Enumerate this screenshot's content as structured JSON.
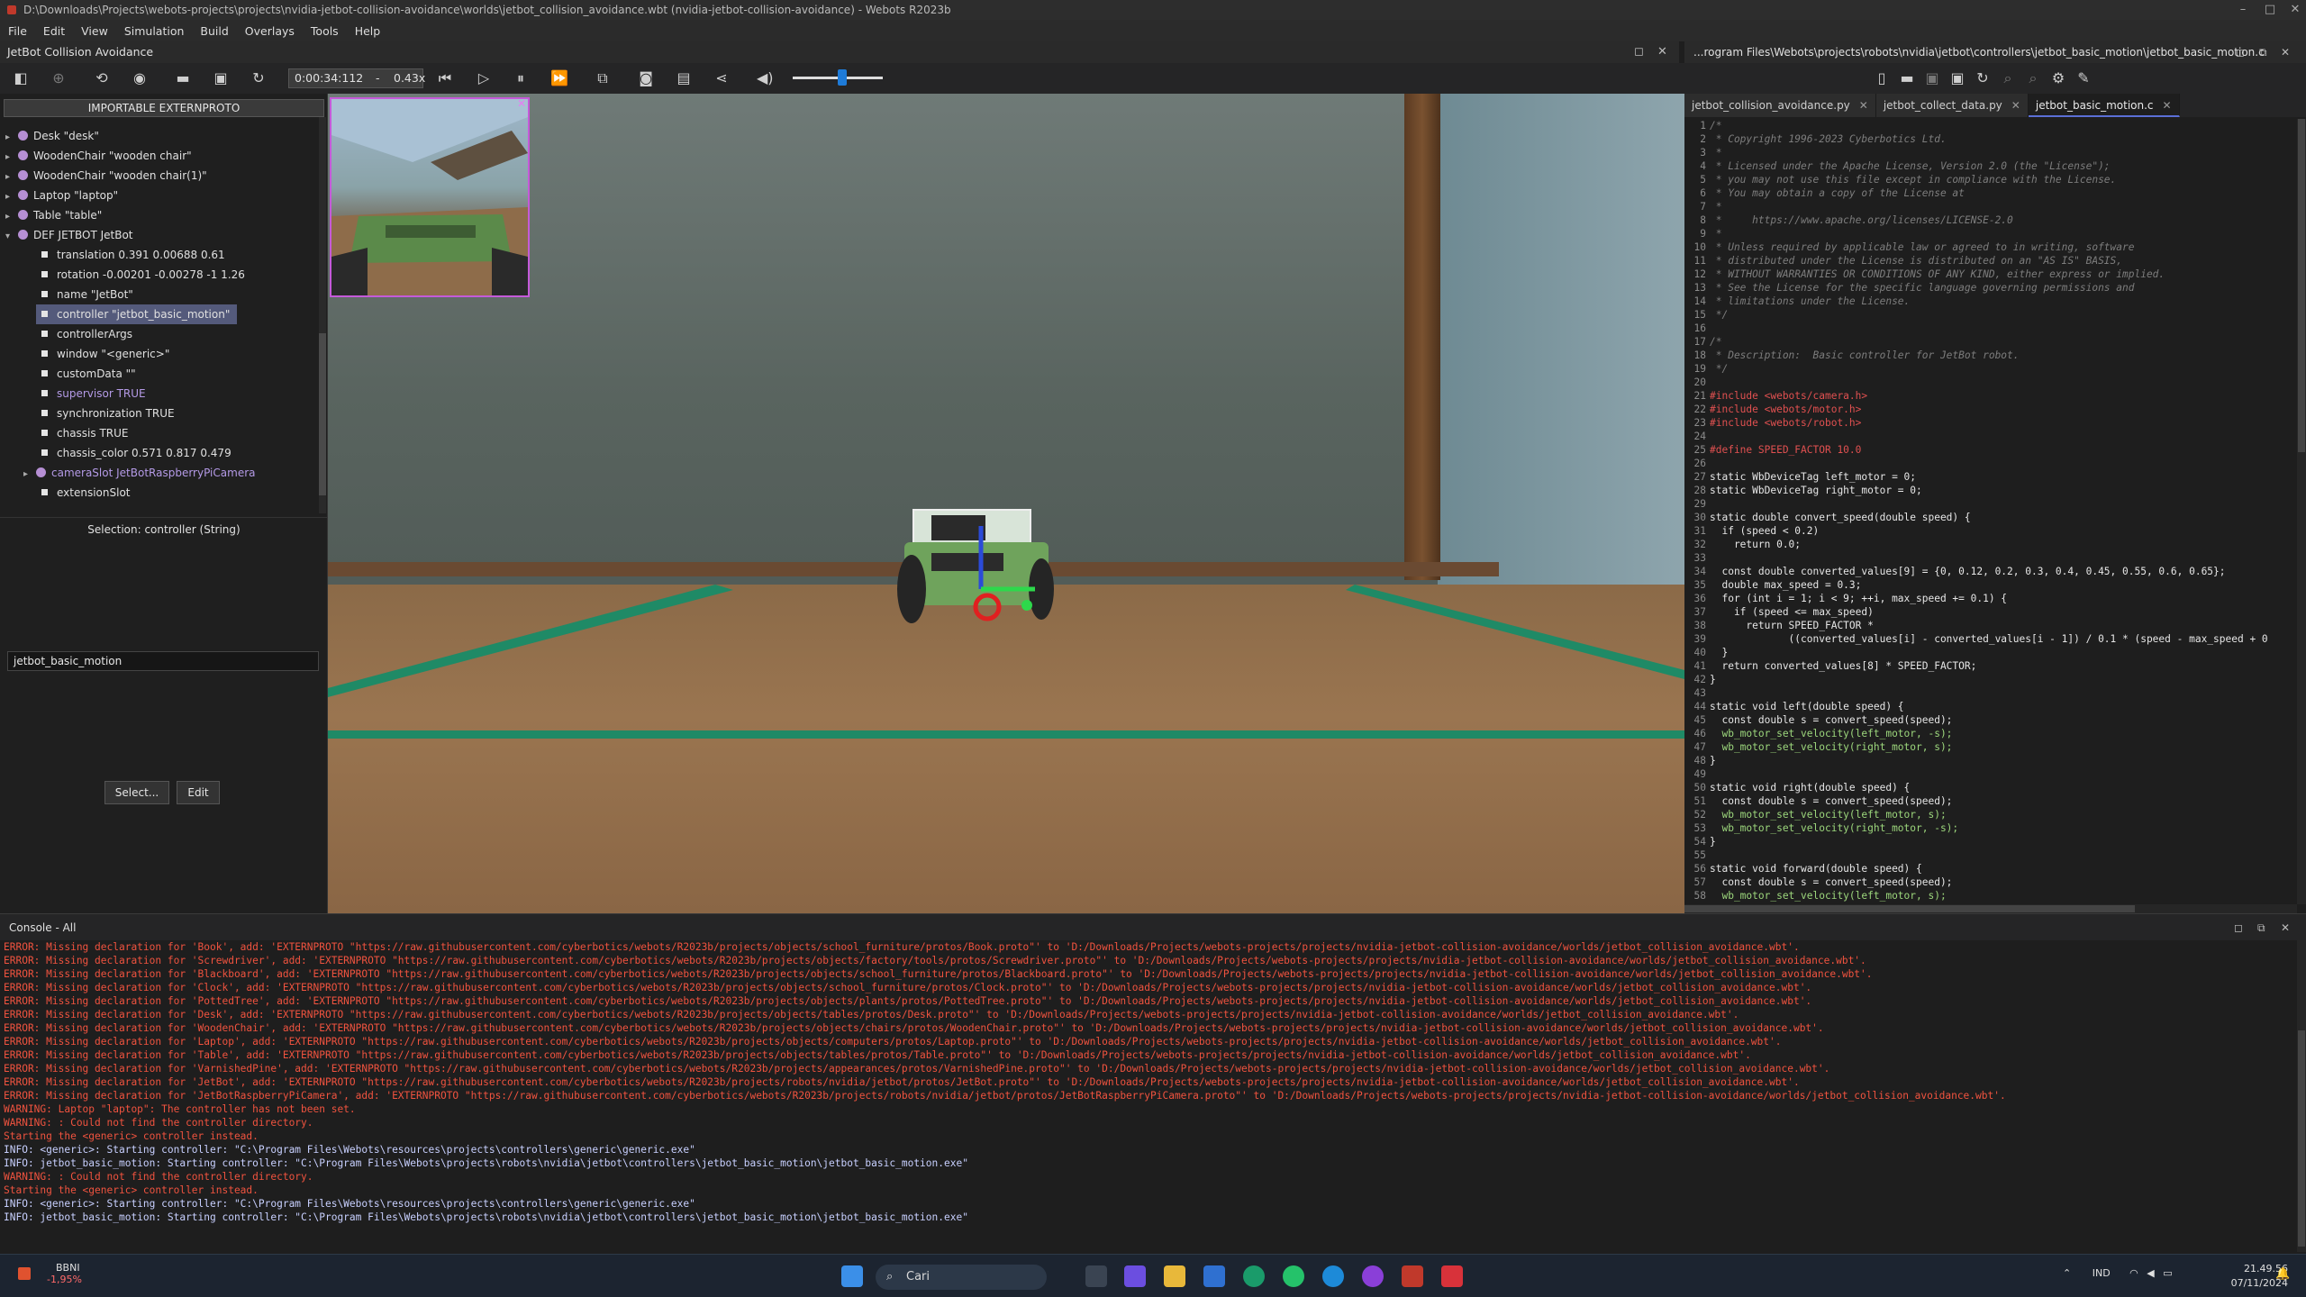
{
  "window": {
    "title": "D:\\Downloads\\Projects\\webots-projects\\projects\\nvidia-jetbot-collision-avoidance\\worlds\\jetbot_collision_avoidance.wbt (nvidia-jetbot-collision-avoidance) - Webots R2023b"
  },
  "menu": [
    "File",
    "Edit",
    "View",
    "Simulation",
    "Build",
    "Overlays",
    "Tools",
    "Help"
  ],
  "world_title": "JetBot Collision Avoidance",
  "toolbar": {
    "time": "0:00:34:112",
    "separator": "-",
    "speed": "0.43x",
    "volume_level": 0.6
  },
  "scene_tree": {
    "header_button": "IMPORTABLE EXTERNPROTO",
    "nodes": [
      {
        "label": "Desk \"desk\"",
        "arrow": "▸"
      },
      {
        "label": "WoodenChair \"wooden chair\"",
        "arrow": "▸"
      },
      {
        "label": "WoodenChair \"wooden chair(1)\"",
        "arrow": "▸"
      },
      {
        "label": "Laptop \"laptop\"",
        "arrow": "▸"
      },
      {
        "label": "Table \"table\"",
        "arrow": "▸"
      },
      {
        "label": "DEF JETBOT JetBot",
        "arrow": "▾"
      }
    ],
    "fields": [
      {
        "label": "translation 0.391 0.00688 0.61"
      },
      {
        "label": "rotation -0.00201 -0.00278 -1 1.26"
      },
      {
        "label": "name \"JetBot\""
      },
      {
        "label": "controller \"jetbot_basic_motion\""
      },
      {
        "label": "controllerArgs"
      },
      {
        "label": "window \"<generic>\""
      },
      {
        "label": "customData \"\""
      },
      {
        "label": "supervisor TRUE"
      },
      {
        "label": "synchronization TRUE"
      },
      {
        "label": "chassis TRUE"
      },
      {
        "label": "chassis_color 0.571 0.817 0.479"
      },
      {
        "label": "cameraSlot JetBotRaspberryPiCamera"
      },
      {
        "label": "extensionSlot"
      }
    ]
  },
  "field_editor": {
    "selection": "Selection: controller (String)",
    "value": "jetbot_basic_motion",
    "select_btn": "Select...",
    "edit_btn": "Edit"
  },
  "editor": {
    "path": "...rogram Files\\Webots\\projects\\robots\\nvidia\\jetbot\\controllers\\jetbot_basic_motion\\jetbot_basic_motion.c",
    "tabs": [
      "jetbot_collision_avoidance.py",
      "jetbot_collect_data.py",
      "jetbot_basic_motion.c"
    ],
    "lines": [
      {
        "n": "1",
        "t": "/*",
        "c": "com"
      },
      {
        "n": "2",
        "t": " * Copyright 1996-2023 Cyberbotics Ltd.",
        "c": "com"
      },
      {
        "n": "3",
        "t": " *",
        "c": "com"
      },
      {
        "n": "4",
        "t": " * Licensed under the Apache License, Version 2.0 (the \"License\");",
        "c": "com"
      },
      {
        "n": "5",
        "t": " * you may not use this file except in compliance with the License.",
        "c": "com"
      },
      {
        "n": "6",
        "t": " * You may obtain a copy of the License at",
        "c": "com"
      },
      {
        "n": "7",
        "t": " *",
        "c": "com"
      },
      {
        "n": "8",
        "t": " *     https://www.apache.org/licenses/LICENSE-2.0",
        "c": "com"
      },
      {
        "n": "9",
        "t": " *",
        "c": "com"
      },
      {
        "n": "10",
        "t": " * Unless required by applicable law or agreed to in writing, software",
        "c": "com"
      },
      {
        "n": "11",
        "t": " * distributed under the License is distributed on an \"AS IS\" BASIS,",
        "c": "com"
      },
      {
        "n": "12",
        "t": " * WITHOUT WARRANTIES OR CONDITIONS OF ANY KIND, either express or implied.",
        "c": "com"
      },
      {
        "n": "13",
        "t": " * See the License for the specific language governing permissions and",
        "c": "com"
      },
      {
        "n": "14",
        "t": " * limitations under the License.",
        "c": "com"
      },
      {
        "n": "15",
        "t": " */",
        "c": "com"
      },
      {
        "n": "16",
        "t": "",
        "c": "txt"
      },
      {
        "n": "17",
        "t": "/*",
        "c": "com"
      },
      {
        "n": "18",
        "t": " * Description:  Basic controller for JetBot robot.",
        "c": "com"
      },
      {
        "n": "19",
        "t": " */",
        "c": "com"
      },
      {
        "n": "20",
        "t": "",
        "c": "txt"
      },
      {
        "n": "21",
        "t": "#include <webots/camera.h>",
        "c": "pre"
      },
      {
        "n": "22",
        "t": "#include <webots/motor.h>",
        "c": "pre"
      },
      {
        "n": "23",
        "t": "#include <webots/robot.h>",
        "c": "pre"
      },
      {
        "n": "24",
        "t": "",
        "c": "txt"
      },
      {
        "n": "25",
        "t": "#define SPEED_FACTOR 10.0",
        "c": "pre"
      },
      {
        "n": "26",
        "t": "",
        "c": "txt"
      },
      {
        "n": "27",
        "t": "static WbDeviceTag left_motor = 0;",
        "c": "txt"
      },
      {
        "n": "28",
        "t": "static WbDeviceTag right_motor = 0;",
        "c": "txt"
      },
      {
        "n": "29",
        "t": "",
        "c": "txt"
      },
      {
        "n": "30",
        "t": "static double convert_speed(double speed) {",
        "c": "txt"
      },
      {
        "n": "31",
        "t": "  if (speed < 0.2)",
        "c": "txt"
      },
      {
        "n": "32",
        "t": "    return 0.0;",
        "c": "txt"
      },
      {
        "n": "33",
        "t": "",
        "c": "txt"
      },
      {
        "n": "34",
        "t": "  const double converted_values[9] = {0, 0.12, 0.2, 0.3, 0.4, 0.45, 0.55, 0.6, 0.65};",
        "c": "txt"
      },
      {
        "n": "35",
        "t": "  double max_speed = 0.3;",
        "c": "txt"
      },
      {
        "n": "36",
        "t": "  for (int i = 1; i < 9; ++i, max_speed += 0.1) {",
        "c": "txt"
      },
      {
        "n": "37",
        "t": "    if (speed <= max_speed)",
        "c": "txt"
      },
      {
        "n": "38",
        "t": "      return SPEED_FACTOR *",
        "c": "txt"
      },
      {
        "n": "39",
        "t": "             ((converted_values[i] - converted_values[i - 1]) / 0.1 * (speed - max_speed + 0",
        "c": "txt"
      },
      {
        "n": "40",
        "t": "  }",
        "c": "txt"
      },
      {
        "n": "41",
        "t": "  return converted_values[8] * SPEED_FACTOR;",
        "c": "txt"
      },
      {
        "n": "42",
        "t": "}",
        "c": "txt"
      },
      {
        "n": "43",
        "t": "",
        "c": "txt"
      },
      {
        "n": "44",
        "t": "static void left(double speed) {",
        "c": "txt"
      },
      {
        "n": "45",
        "t": "  const double s = convert_speed(speed);",
        "c": "txt"
      },
      {
        "n": "46",
        "t": "  wb_motor_set_velocity(left_motor, -s);",
        "c": "fn"
      },
      {
        "n": "47",
        "t": "  wb_motor_set_velocity(right_motor, s);",
        "c": "fn"
      },
      {
        "n": "48",
        "t": "}",
        "c": "txt"
      },
      {
        "n": "49",
        "t": "",
        "c": "txt"
      },
      {
        "n": "50",
        "t": "static void right(double speed) {",
        "c": "txt"
      },
      {
        "n": "51",
        "t": "  const double s = convert_speed(speed);",
        "c": "txt"
      },
      {
        "n": "52",
        "t": "  wb_motor_set_velocity(left_motor, s);",
        "c": "fn"
      },
      {
        "n": "53",
        "t": "  wb_motor_set_velocity(right_motor, -s);",
        "c": "fn"
      },
      {
        "n": "54",
        "t": "}",
        "c": "txt"
      },
      {
        "n": "55",
        "t": "",
        "c": "txt"
      },
      {
        "n": "56",
        "t": "static void forward(double speed) {",
        "c": "txt"
      },
      {
        "n": "57",
        "t": "  const double s = convert_speed(speed);",
        "c": "txt"
      },
      {
        "n": "58",
        "t": "  wb_motor_set_velocity(left_motor, s);",
        "c": "fn"
      }
    ]
  },
  "console": {
    "title": "Console - All",
    "lines": [
      {
        "t": "ERROR: Missing declaration for 'Book', add: 'EXTERNPROTO \"https://raw.githubusercontent.com/cyberbotics/webots/R2023b/projects/objects/school_furniture/protos/Book.proto\"' to 'D:/Downloads/Projects/webots-projects/projects/nvidia-jetbot-collision-avoidance/worlds/jetbot_collision_avoidance.wbt'.",
        "k": "error"
      },
      {
        "t": "ERROR: Missing declaration for 'Screwdriver', add: 'EXTERNPROTO \"https://raw.githubusercontent.com/cyberbotics/webots/R2023b/projects/objects/factory/tools/protos/Screwdriver.proto\"' to 'D:/Downloads/Projects/webots-projects/projects/nvidia-jetbot-collision-avoidance/worlds/jetbot_collision_avoidance.wbt'.",
        "k": "error"
      },
      {
        "t": "ERROR: Missing declaration for 'Blackboard', add: 'EXTERNPROTO \"https://raw.githubusercontent.com/cyberbotics/webots/R2023b/projects/objects/school_furniture/protos/Blackboard.proto\"' to 'D:/Downloads/Projects/webots-projects/projects/nvidia-jetbot-collision-avoidance/worlds/jetbot_collision_avoidance.wbt'.",
        "k": "error"
      },
      {
        "t": "ERROR: Missing declaration for 'Clock', add: 'EXTERNPROTO \"https://raw.githubusercontent.com/cyberbotics/webots/R2023b/projects/objects/school_furniture/protos/Clock.proto\"' to 'D:/Downloads/Projects/webots-projects/projects/nvidia-jetbot-collision-avoidance/worlds/jetbot_collision_avoidance.wbt'.",
        "k": "error"
      },
      {
        "t": "ERROR: Missing declaration for 'PottedTree', add: 'EXTERNPROTO \"https://raw.githubusercontent.com/cyberbotics/webots/R2023b/projects/objects/plants/protos/PottedTree.proto\"' to 'D:/Downloads/Projects/webots-projects/projects/nvidia-jetbot-collision-avoidance/worlds/jetbot_collision_avoidance.wbt'.",
        "k": "error"
      },
      {
        "t": "ERROR: Missing declaration for 'Desk', add: 'EXTERNPROTO \"https://raw.githubusercontent.com/cyberbotics/webots/R2023b/projects/objects/tables/protos/Desk.proto\"' to 'D:/Downloads/Projects/webots-projects/projects/nvidia-jetbot-collision-avoidance/worlds/jetbot_collision_avoidance.wbt'.",
        "k": "error"
      },
      {
        "t": "ERROR: Missing declaration for 'WoodenChair', add: 'EXTERNPROTO \"https://raw.githubusercontent.com/cyberbotics/webots/R2023b/projects/objects/chairs/protos/WoodenChair.proto\"' to 'D:/Downloads/Projects/webots-projects/projects/nvidia-jetbot-collision-avoidance/worlds/jetbot_collision_avoidance.wbt'.",
        "k": "error"
      },
      {
        "t": "ERROR: Missing declaration for 'Laptop', add: 'EXTERNPROTO \"https://raw.githubusercontent.com/cyberbotics/webots/R2023b/projects/objects/computers/protos/Laptop.proto\"' to 'D:/Downloads/Projects/webots-projects/projects/nvidia-jetbot-collision-avoidance/worlds/jetbot_collision_avoidance.wbt'.",
        "k": "error"
      },
      {
        "t": "ERROR: Missing declaration for 'Table', add: 'EXTERNPROTO \"https://raw.githubusercontent.com/cyberbotics/webots/R2023b/projects/objects/tables/protos/Table.proto\"' to 'D:/Downloads/Projects/webots-projects/projects/nvidia-jetbot-collision-avoidance/worlds/jetbot_collision_avoidance.wbt'.",
        "k": "error"
      },
      {
        "t": "ERROR: Missing declaration for 'VarnishedPine', add: 'EXTERNPROTO \"https://raw.githubusercontent.com/cyberbotics/webots/R2023b/projects/appearances/protos/VarnishedPine.proto\"' to 'D:/Downloads/Projects/webots-projects/projects/nvidia-jetbot-collision-avoidance/worlds/jetbot_collision_avoidance.wbt'.",
        "k": "error"
      },
      {
        "t": "ERROR: Missing declaration for 'JetBot', add: 'EXTERNPROTO \"https://raw.githubusercontent.com/cyberbotics/webots/R2023b/projects/robots/nvidia/jetbot/protos/JetBot.proto\"' to 'D:/Downloads/Projects/webots-projects/projects/nvidia-jetbot-collision-avoidance/worlds/jetbot_collision_avoidance.wbt'.",
        "k": "error"
      },
      {
        "t": "ERROR: Missing declaration for 'JetBotRaspberryPiCamera', add: 'EXTERNPROTO \"https://raw.githubusercontent.com/cyberbotics/webots/R2023b/projects/robots/nvidia/jetbot/protos/JetBotRaspberryPiCamera.proto\"' to 'D:/Downloads/Projects/webots-projects/projects/nvidia-jetbot-collision-avoidance/worlds/jetbot_collision_avoidance.wbt'.",
        "k": "error"
      },
      {
        "t": "WARNING: Laptop \"laptop\": The controller has not been set.",
        "k": "warning"
      },
      {
        "t": "WARNING: : Could not find the controller directory.",
        "k": "warning"
      },
      {
        "t": "Starting the <generic> controller instead.",
        "k": "warning"
      },
      {
        "t": "INFO: <generic>: Starting controller: \"C:\\Program Files\\Webots\\resources\\projects\\controllers\\generic\\generic.exe\"",
        "k": "info"
      },
      {
        "t": "INFO: jetbot_basic_motion: Starting controller: \"C:\\Program Files\\Webots\\projects\\robots\\nvidia\\jetbot\\controllers\\jetbot_basic_motion\\jetbot_basic_motion.exe\"",
        "k": "info"
      },
      {
        "t": "WARNING: : Could not find the controller directory.",
        "k": "warning"
      },
      {
        "t": "Starting the <generic> controller instead.",
        "k": "warning"
      },
      {
        "t": "INFO: <generic>: Starting controller: \"C:\\Program Files\\Webots\\resources\\projects\\controllers\\generic\\generic.exe\"",
        "k": "info"
      },
      {
        "t": "INFO: jetbot_basic_motion: Starting controller: \"C:\\Program Files\\Webots\\projects\\robots\\nvidia\\jetbot\\controllers\\jetbot_basic_motion\\jetbot_basic_motion.exe\"",
        "k": "info"
      }
    ]
  },
  "taskbar": {
    "stock_name": "BBNI",
    "stock_change": "-1,95%",
    "search": "Cari",
    "lang": "IND",
    "time": "21.49.56",
    "date": "07/11/2024"
  }
}
